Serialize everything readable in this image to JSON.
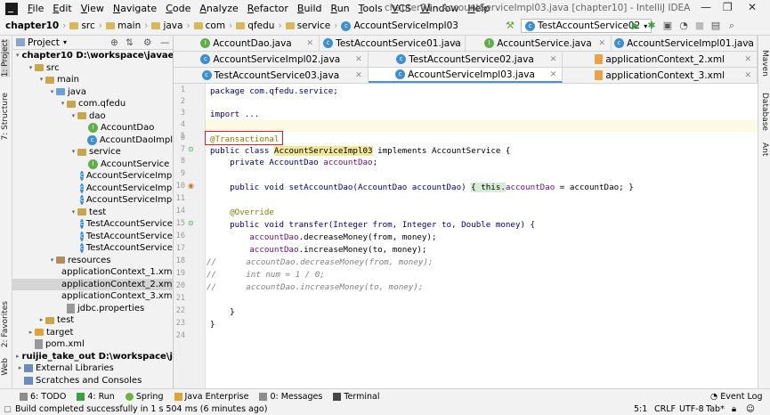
{
  "menu": [
    "File",
    "Edit",
    "View",
    "Navigate",
    "Code",
    "Analyze",
    "Refactor",
    "Build",
    "Run",
    "Tools",
    "VCS",
    "Window",
    "Help"
  ],
  "window_title": "chapter01 - AccountServiceImpl03.java [chapter10] - IntelliJ IDEA",
  "breadcrumb": [
    "chapter10",
    "src",
    "main",
    "java",
    "com",
    "qfedu",
    "service",
    "AccountServiceImpl03"
  ],
  "run_config": "TestAccountService02",
  "left_tabs": [
    "1: Project",
    "7: Structure",
    "2: Favorites",
    "Web"
  ],
  "right_tabs": [
    "Maven",
    "Database",
    "Ant"
  ],
  "project_panel": {
    "title": "Project",
    "tree": [
      {
        "label": "chapter10  D:\\workspace\\javaee\\chapte",
        "indent": 1,
        "icon": "folder",
        "arrow": "▾"
      },
      {
        "label": "src",
        "indent": 2,
        "icon": "folder",
        "arrow": "▾"
      },
      {
        "label": "main",
        "indent": 3,
        "icon": "folder",
        "arrow": "▾"
      },
      {
        "label": "java",
        "indent": 4,
        "icon": "src",
        "arrow": "▾"
      },
      {
        "label": "com.qfedu",
        "indent": 5,
        "icon": "pkg",
        "arrow": "▾"
      },
      {
        "label": "dao",
        "indent": 6,
        "icon": "pkg",
        "arrow": "▾"
      },
      {
        "label": "AccountDao",
        "indent": 7,
        "icon": "interface",
        "arrow": ""
      },
      {
        "label": "AccountDaoImpl",
        "indent": 7,
        "icon": "class",
        "arrow": ""
      },
      {
        "label": "service",
        "indent": 6,
        "icon": "pkg",
        "arrow": "▾"
      },
      {
        "label": "AccountService",
        "indent": 7,
        "icon": "interface",
        "arrow": ""
      },
      {
        "label": "AccountServiceImpl0",
        "indent": 7,
        "icon": "class",
        "arrow": ""
      },
      {
        "label": "AccountServiceImpl0",
        "indent": 7,
        "icon": "class",
        "arrow": ""
      },
      {
        "label": "AccountServiceImpl0",
        "indent": 7,
        "icon": "class",
        "arrow": ""
      },
      {
        "label": "test",
        "indent": 6,
        "icon": "pkg",
        "arrow": "▾"
      },
      {
        "label": "TestAccountService0",
        "indent": 7,
        "icon": "class",
        "arrow": ""
      },
      {
        "label": "TestAccountService0",
        "indent": 7,
        "icon": "class",
        "arrow": ""
      },
      {
        "label": "TestAccountService0",
        "indent": 7,
        "icon": "class",
        "arrow": ""
      },
      {
        "label": "resources",
        "indent": 4,
        "icon": "res",
        "arrow": "▾"
      },
      {
        "label": "applicationContext_1.xml",
        "indent": 5,
        "icon": "xml",
        "arrow": ""
      },
      {
        "label": "applicationContext_2.xml",
        "indent": 5,
        "icon": "xml",
        "arrow": "",
        "selected": true
      },
      {
        "label": "applicationContext_3.xml",
        "indent": 5,
        "icon": "xml",
        "arrow": ""
      },
      {
        "label": "jdbc.properties",
        "indent": 5,
        "icon": "prop",
        "arrow": ""
      },
      {
        "label": "test",
        "indent": 3,
        "icon": "folder",
        "arrow": "▸"
      },
      {
        "label": "target",
        "indent": 2,
        "icon": "target",
        "arrow": "▸"
      },
      {
        "label": "pom.xml",
        "indent": 2,
        "icon": "maven",
        "arrow": ""
      },
      {
        "label": "ruijie_take_out  D:\\workspace\\javaee\\ru",
        "indent": 1,
        "icon": "folder",
        "arrow": "▸"
      },
      {
        "label": "External Libraries",
        "indent": 1,
        "icon": "lib",
        "arrow": "▸"
      },
      {
        "label": "Scratches and Consoles",
        "indent": 1,
        "icon": "scratch",
        "arrow": ""
      }
    ]
  },
  "tabs_row1": [
    "AccountDao.java",
    "TestAccountService01.java",
    "AccountService.java",
    "AccountServiceImpl01.java"
  ],
  "tabs_row2": [
    "AccountServiceImpl02.java",
    "TestAccountService02.java",
    "applicationContext_2.xml"
  ],
  "tabs_row3": [
    "TestAccountService03.java",
    "AccountServiceImpl03.java",
    "applicationContext_3.xml"
  ],
  "editor": {
    "line_numbers": [
      "1",
      "2",
      "3",
      "4",
      "5",
      "6",
      "7",
      "8",
      "9",
      "10",
      "11",
      "14",
      "15",
      "16",
      "17",
      "18",
      "19",
      "20",
      "21",
      "22",
      "23",
      "24",
      "25"
    ],
    "lines": {
      "l1": "package com.qfedu.service;",
      "l3": "import ...",
      "l6": "@Transactional",
      "l7_a": "public class ",
      "l7_b": "AccountServiceImpl03",
      "l7_c": " implements AccountService {",
      "l8_a": "    private AccountDao ",
      "l8_b": "accountDao",
      "l8_c": ";",
      "l10_a": "    public void setAccountDao(AccountDao accountDao) ",
      "l10_b": "{ this.",
      "l10_c": "accountDao",
      "l10_d": " = accountDao; }",
      "l15": "    @Override",
      "l16": "    public void transfer(Integer from, Integer to, Double money) {",
      "l17_a": "        ",
      "l17_b": "accountDao",
      "l17_c": ".decreaseMoney(from, money);",
      "l18_a": "        ",
      "l18_b": "accountDao",
      "l18_c": ".increaseMoney(to, money);",
      "l19": "//      accountDao.decreaseMoney(from, money);",
      "l20": "//      int num = 1 / 0;",
      "l21": "//      accountDao.increaseMoney(to, money);",
      "l23": "    }",
      "l24": "}"
    }
  },
  "bottom_tools": [
    "6: TODO",
    "4: Run",
    "Spring",
    "Java Enterprise",
    "0: Messages",
    "Terminal"
  ],
  "event_log": "Event Log",
  "status": {
    "message": "Build completed successfully in 1 s 504 ms (6 minutes ago)",
    "position": "5:1",
    "line_sep": "CRLF",
    "encoding": "UTF-8",
    "indent": "Tab*"
  }
}
